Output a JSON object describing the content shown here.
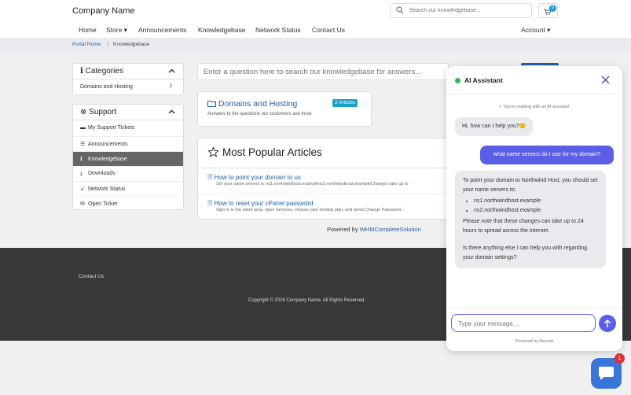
{
  "header": {
    "brand": "Company Name",
    "search_placeholder": "Search our knowledgebase...",
    "cart_count": "0",
    "nav": [
      "Home",
      "Store ▾",
      "Announcements",
      "Knowledgebase",
      "Network Status",
      "Contact Us"
    ],
    "account": "Account ▾"
  },
  "breadcrumb": {
    "home": "Portal Home",
    "sep": "/",
    "current": "Knowledgebase"
  },
  "categories": {
    "title": "Categories",
    "items": [
      {
        "label": "Domains and Hosting",
        "count": "2"
      }
    ]
  },
  "support": {
    "title": "Support",
    "items": [
      {
        "icon": "ticket-icon",
        "label": "My Support Tickets"
      },
      {
        "icon": "list-icon",
        "label": "Announcements"
      },
      {
        "icon": "info-icon",
        "label": "Knowledgebase",
        "active": true
      },
      {
        "icon": "download-icon",
        "label": "Downloads"
      },
      {
        "icon": "rocket-icon",
        "label": "Network Status"
      },
      {
        "icon": "comments-icon",
        "label": "Open Ticket"
      }
    ]
  },
  "kb": {
    "search_placeholder": "Enter a question here to search our knowledgebase for answers...",
    "category": {
      "title": "Domains and Hosting",
      "badge": "2 Articles",
      "description": "Answers to the questions our customers ask most"
    },
    "popular_title": "Most Popular Articles",
    "articles": [
      {
        "title": "How to point your domain to us",
        "excerpt": "Set your name servers to ns1.northwindhost.examplens2.northwindhost.exampleChanges take up to"
      },
      {
        "title": "How to reset your cPanel password",
        "excerpt": "Sign in to the client area, open Services, choose your hosting plan, and press Change Password..."
      }
    ],
    "powered_prefix": "Powered by",
    "powered_link": "WHMCompleteSolution"
  },
  "footer": {
    "contact": "Contact Us",
    "copyright": "Copyright © 2026 Company Name. All Rights Reserved."
  },
  "chat": {
    "title": "AI Assistant",
    "notice": "You're chatting with an AI assistant",
    "greeting": "Hi, how can I help you?😊",
    "user_message": "what name servers do I use for my domain?",
    "reply_intro": "To point your domain to Northwind Host, you should set your name servers to:",
    "reply_ns": [
      "ns1.northwindhost.example",
      "ns2.northwindhost.example"
    ],
    "reply_note": "Please note that these changes can take up to 24 hours to spread across the internet.",
    "reply_question": "Is there anything else I can help you with regarding your domain settings?",
    "input_placeholder": "Type your message...",
    "powered": "Powered by Asyntai",
    "launcher_badge": "1"
  },
  "colors": {
    "accent": "#5b5fe8",
    "link": "#1f5ea8",
    "online": "#36b35a",
    "launcher": "#3a76d8"
  }
}
